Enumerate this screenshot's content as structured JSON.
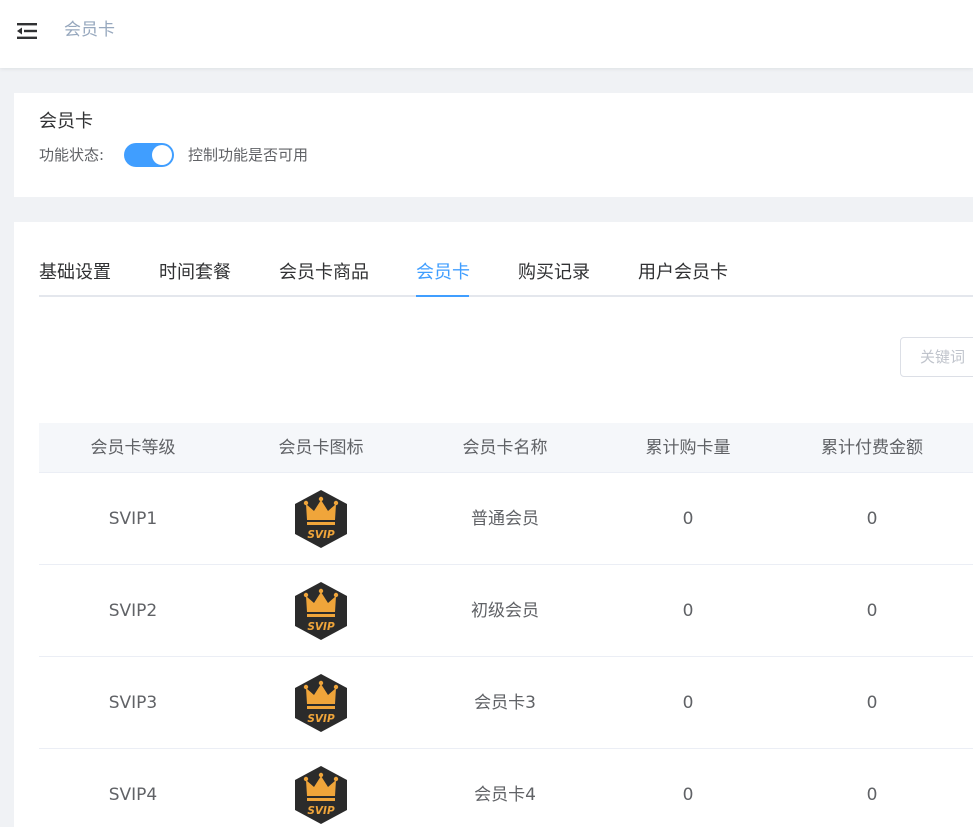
{
  "header": {
    "breadcrumb_current": "会员卡"
  },
  "status_card": {
    "title": "会员卡",
    "status_label": "功能状态:",
    "switch_on": true,
    "description": "控制功能是否可用"
  },
  "tabs": [
    {
      "label": "基础设置",
      "active": false
    },
    {
      "label": "时间套餐",
      "active": false
    },
    {
      "label": "会员卡商品",
      "active": false
    },
    {
      "label": "会员卡",
      "active": true
    },
    {
      "label": "购买记录",
      "active": false
    },
    {
      "label": "用户会员卡",
      "active": false
    }
  ],
  "search": {
    "placeholder": "关键词"
  },
  "table": {
    "columns": [
      "会员卡等级",
      "会员卡图标",
      "会员卡名称",
      "累计购卡量",
      "累计付费金额"
    ],
    "rows": [
      {
        "level": "SVIP1",
        "icon": "svip-crown-badge-icon",
        "name": "普通会员",
        "purchases": "0",
        "amount": "0"
      },
      {
        "level": "SVIP2",
        "icon": "svip-crown-badge-icon",
        "name": "初级会员",
        "purchases": "0",
        "amount": "0"
      },
      {
        "level": "SVIP3",
        "icon": "svip-crown-badge-icon",
        "name": "会员卡3",
        "purchases": "0",
        "amount": "0"
      },
      {
        "level": "SVIP4",
        "icon": "svip-crown-badge-icon",
        "name": "会员卡4",
        "purchases": "0",
        "amount": "0"
      }
    ],
    "badge_text": "SVIP"
  },
  "colors": {
    "accent": "#409eff",
    "badge_dark": "#2b2b2b",
    "badge_gold": "#f0a53a"
  }
}
